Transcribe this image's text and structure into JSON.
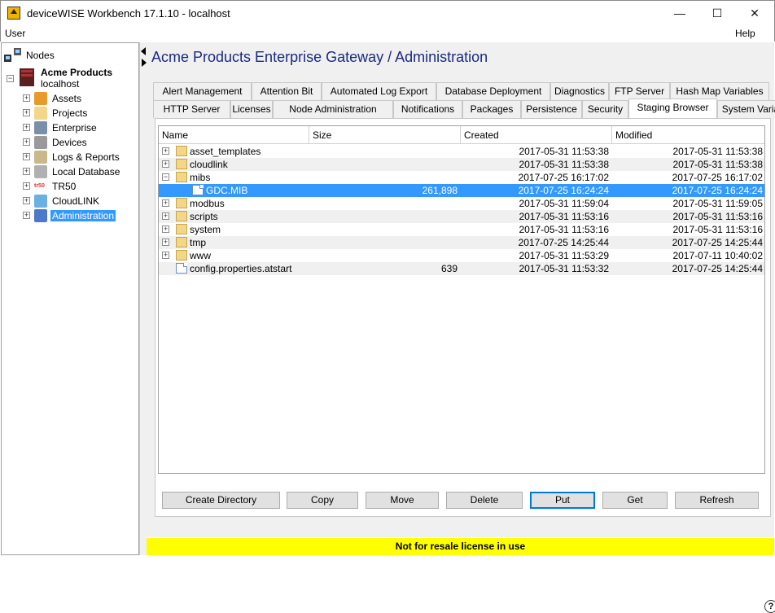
{
  "window": {
    "title": "deviceWISE Workbench 17.1.10  -  localhost",
    "minimize_glyph": "—",
    "maximize_glyph": "☐",
    "close_glyph": "✕"
  },
  "menu": {
    "user": "User",
    "help": "Help"
  },
  "tree": {
    "root": "Nodes",
    "node_name": "Acme Products",
    "node_host": "localhost",
    "items": [
      {
        "label": "Assets",
        "icon": "assets-icon"
      },
      {
        "label": "Projects",
        "icon": "projects-icon"
      },
      {
        "label": "Enterprise",
        "icon": "enterprise-icon"
      },
      {
        "label": "Devices",
        "icon": "devices-icon"
      },
      {
        "label": "Logs & Reports",
        "icon": "logs-icon"
      },
      {
        "label": "Local Database",
        "icon": "database-icon"
      },
      {
        "label": "TR50",
        "icon": "tr50-icon"
      },
      {
        "label": "CloudLINK",
        "icon": "cloud-icon"
      },
      {
        "label": "Administration",
        "icon": "admin-icon",
        "selected": true
      }
    ]
  },
  "main": {
    "title": "Acme Products Enterprise Gateway / Administration",
    "tabs_row1": [
      "Alert Management",
      "Attention Bit",
      "Automated Log Export",
      "Database Deployment",
      "Diagnostics",
      "FTP Server",
      "Hash Map Variables"
    ],
    "tabs_row2": [
      "HTTP Server",
      "Licenses",
      "Node Administration",
      "Notifications",
      "Packages",
      "Persistence",
      "Security",
      "Staging Browser",
      "System Variables"
    ],
    "selected_tab": "Staging Browser",
    "table": {
      "columns": [
        "Name",
        "Size",
        "Created",
        "Modified"
      ],
      "rows": [
        {
          "name": "asset_templates",
          "size": "",
          "created": "2017-05-31 11:53:38",
          "modified": "2017-05-31 11:53:38",
          "type": "folder",
          "expander": "+",
          "indent": 0
        },
        {
          "name": "cloudlink",
          "size": "",
          "created": "2017-05-31 11:53:38",
          "modified": "2017-05-31 11:53:38",
          "type": "folder",
          "expander": "+",
          "indent": 0
        },
        {
          "name": "mibs",
          "size": "",
          "created": "2017-07-25 16:17:02",
          "modified": "2017-07-25 16:17:02",
          "type": "folder",
          "expander": "−",
          "indent": 0
        },
        {
          "name": "GDC.MIB",
          "size": "261,898",
          "created": "2017-07-25 16:24:24",
          "modified": "2017-07-25 16:24:24",
          "type": "file",
          "expander": "",
          "indent": 1,
          "selected": true
        },
        {
          "name": "modbus",
          "size": "",
          "created": "2017-05-31 11:59:04",
          "modified": "2017-05-31 11:59:05",
          "type": "folder",
          "expander": "+",
          "indent": 0
        },
        {
          "name": "scripts",
          "size": "",
          "created": "2017-05-31 11:53:16",
          "modified": "2017-05-31 11:53:16",
          "type": "folder",
          "expander": "+",
          "indent": 0
        },
        {
          "name": "system",
          "size": "",
          "created": "2017-05-31 11:53:16",
          "modified": "2017-05-31 11:53:16",
          "type": "folder",
          "expander": "+",
          "indent": 0
        },
        {
          "name": "tmp",
          "size": "",
          "created": "2017-07-25 14:25:44",
          "modified": "2017-07-25 14:25:44",
          "type": "folder",
          "expander": "+",
          "indent": 0
        },
        {
          "name": "www",
          "size": "",
          "created": "2017-05-31 11:53:29",
          "modified": "2017-07-11 10:40:02",
          "type": "folder",
          "expander": "+",
          "indent": 0
        },
        {
          "name": "config.properties.atstart",
          "size": "639",
          "created": "2017-05-31 11:53:32",
          "modified": "2017-07-25 14:25:44",
          "type": "file",
          "expander": "",
          "indent": 0
        }
      ]
    },
    "buttons": [
      "Create Directory",
      "Copy",
      "Move",
      "Delete",
      "Put",
      "Get",
      "Refresh"
    ],
    "focused_button": "Put",
    "help_glyph": "?",
    "license_notice": "Not for resale license in use"
  }
}
